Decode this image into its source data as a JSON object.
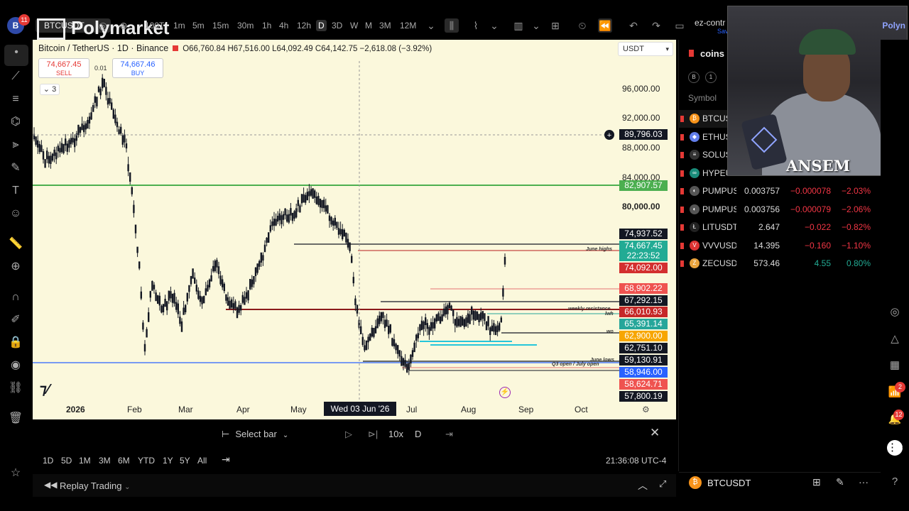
{
  "topbar": {
    "avatar_letter": "B",
    "avatar_badge": "11",
    "symbol": "BTCUSDT",
    "watermark": "Polymarket",
    "intervals": [
      "100T",
      "1m",
      "5m",
      "15m",
      "30m",
      "1h",
      "4h",
      "12h",
      "D",
      "3D",
      "W",
      "M",
      "3M",
      "12M"
    ],
    "active_interval": "D",
    "layout_label": "ez-contr",
    "layout_sub": "Sav"
  },
  "chart": {
    "symbol_title": "Bitcoin / TetherUS · 1D · Binance",
    "ohlc": "O66,760.84 H67,516.00 L64,092.49 C64,142.75 −2,618.08 (−3.92%)",
    "sell_price": "74,667.45",
    "sell_label": "SELL",
    "buy_price": "74,667.46",
    "buy_label": "BUY",
    "spread": "0.01",
    "indicators_count": "3",
    "currency": "USDT",
    "crosshair_price": "89,796.03",
    "crosshair_date": "Wed 03 Jun '26",
    "price_axis": [
      "96,000.00",
      "92,000.00",
      "88,000.00",
      "84,000.00",
      "80,000.00"
    ],
    "time_axis": [
      "2026",
      "Feb",
      "Mar",
      "Apr",
      "May",
      "Jul",
      "Aug",
      "Sep",
      "Oct"
    ],
    "price_labels": [
      {
        "v": "82,907.57",
        "color": "#4caf50"
      },
      {
        "v": "74,937.52",
        "color": "#131722"
      },
      {
        "v": "74,667.45",
        "color": "#22ab94"
      },
      {
        "v": "22:23:52",
        "color": "#22ab94"
      },
      {
        "v": "74,092.00",
        "color": "#d32f2f"
      },
      {
        "v": "68,902.22",
        "color": "#ef5350"
      },
      {
        "v": "67,292.15",
        "color": "#131722"
      },
      {
        "v": "66,010.93",
        "color": "#c62828"
      },
      {
        "v": "65,391.14",
        "color": "#26a69a"
      },
      {
        "v": "62,900.00",
        "color": "#f7a600"
      },
      {
        "v": "62,751.10",
        "color": "#131722"
      },
      {
        "v": "59,130.91",
        "color": "#131722"
      },
      {
        "v": "58,946.00",
        "color": "#2962ff"
      },
      {
        "v": "58,624.71",
        "color": "#ef5350"
      },
      {
        "v": "57,800.19",
        "color": "#131722"
      }
    ],
    "annotations": {
      "june_highs": "June highs",
      "weekly_resistance": "weekly resistance",
      "lwh": "lwh",
      "wo": "wo",
      "june_lows": "June lows",
      "q3_open": "Q3 open / July open"
    }
  },
  "replay": {
    "select_bar": "Select bar",
    "speed": "10x",
    "interval": "D",
    "replay_trading": "Replay Trading"
  },
  "ranges": [
    "1D",
    "5D",
    "1M",
    "3M",
    "6M",
    "YTD",
    "1Y",
    "5Y",
    "All"
  ],
  "clock": "21:36:08 UTC-4",
  "watchlist": {
    "title": "coins",
    "buttons": [
      "B",
      "1"
    ],
    "symbol_header": "Symbol",
    "rows": [
      {
        "sym": "BTCUSDT",
        "last": "",
        "chg": "",
        "chp": "",
        "dir": "neg",
        "icon": "₿",
        "icolor": "#f7931a"
      },
      {
        "sym": "ETHUSDT",
        "last": "",
        "chg": "",
        "chp": "",
        "dir": "neg",
        "icon": "◆",
        "icolor": "#627eea"
      },
      {
        "sym": "SOLUSDT",
        "last": "",
        "chg": "",
        "chp": "",
        "dir": "neg",
        "icon": "≡",
        "icolor": "#333"
      },
      {
        "sym": "HYPEUSDT",
        "last": "",
        "chg": "",
        "chp": "",
        "dir": "neg",
        "icon": "∞",
        "icolor": "#1a8c7a"
      },
      {
        "sym": "PUMPUSDT",
        "last": "0.003757",
        "chg": "−0.000078",
        "chp": "−2.03%",
        "dir": "neg",
        "icon": "◐",
        "icolor": "#555"
      },
      {
        "sym": "PUMPUSDT",
        "last": "0.003756",
        "chg": "−0.000079",
        "chp": "−2.06%",
        "dir": "neg",
        "icon": "◐",
        "icolor": "#555"
      },
      {
        "sym": "LITUSDT",
        "last": "2.647",
        "chg": "−0.022",
        "chp": "−0.82%",
        "dir": "neg",
        "icon": "Ł",
        "icolor": "#222"
      },
      {
        "sym": "VVVUSDT",
        "last": "14.395",
        "chg": "−0.160",
        "chp": "−1.10%",
        "dir": "neg",
        "icon": "V",
        "icolor": "#d33"
      },
      {
        "sym": "ZECUSDT",
        "last": "573.46",
        "chg": "4.55",
        "chp": "0.80%",
        "dir": "pos",
        "icon": "Z",
        "icolor": "#e8a33d"
      }
    ]
  },
  "webcam": {
    "name": "ANSEM",
    "brand": "Polyn"
  },
  "right_badges": {
    "signals": "2",
    "alerts": "12"
  },
  "bottom_symbol": "BTCUSDT"
}
